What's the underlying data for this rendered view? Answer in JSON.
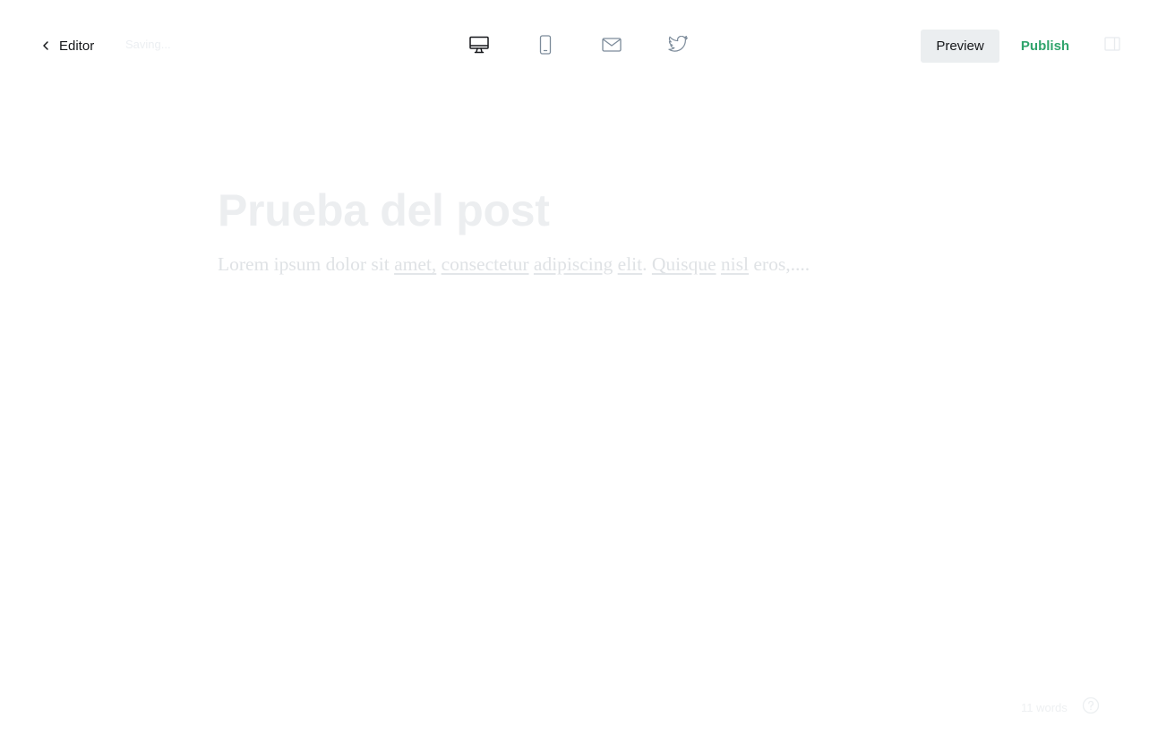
{
  "header": {
    "back_label": "Editor",
    "save_status": "Saving...",
    "devices": [
      {
        "name": "desktop",
        "icon": "desktop-icon",
        "active": true
      },
      {
        "name": "mobile",
        "icon": "mobile-icon",
        "active": false
      },
      {
        "name": "email",
        "icon": "email-icon",
        "active": false
      },
      {
        "name": "twitter",
        "icon": "twitter-icon",
        "active": false
      }
    ],
    "preview_label": "Preview",
    "publish_label": "Publish",
    "settings_icon": "sidebar-toggle-icon"
  },
  "post": {
    "title": "Prueba del post",
    "body_segments": [
      {
        "text": "Lorem ipsum dolor sit ",
        "underline": false
      },
      {
        "text": "amet,",
        "underline": true
      },
      {
        "text": " ",
        "underline": false
      },
      {
        "text": "consectetur",
        "underline": true
      },
      {
        "text": " ",
        "underline": false
      },
      {
        "text": "adipiscing",
        "underline": true
      },
      {
        "text": " ",
        "underline": false
      },
      {
        "text": "elit",
        "underline": true
      },
      {
        "text": ". ",
        "underline": false
      },
      {
        "text": "Quisque",
        "underline": true
      },
      {
        "text": " ",
        "underline": false
      },
      {
        "text": "nisl",
        "underline": true
      },
      {
        "text": " eros,....",
        "underline": false
      }
    ]
  },
  "footer": {
    "word_count": "11 words",
    "help_icon": "help-icon"
  },
  "colors": {
    "publish_accent": "#30a46c",
    "preview_bg": "#ebeef0",
    "title_text": "#eceef0",
    "body_text": "#dfe2e5"
  }
}
